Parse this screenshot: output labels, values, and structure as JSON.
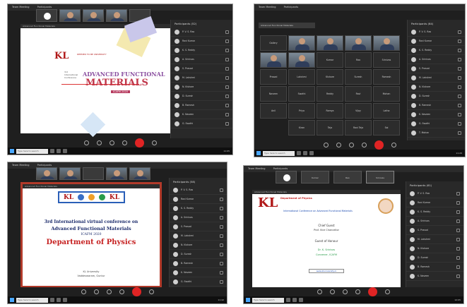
{
  "panels": [
    {
      "title_bar": "Team Meeting",
      "menu": "Participants",
      "share_title": "Advanced Functional Materials",
      "slide": {
        "logo": "KL",
        "logo_tagline": "DEEMED TO BE UNIVERSITY",
        "side_text": "3rd International Conference",
        "heading_line1": "ADVANCED FUNCTIONAL",
        "heading_line2": "MATERIALS",
        "badge": "ICAFM 2020"
      },
      "sidebar_title": "Participants (52)",
      "participants": [
        "P. V. S. Rao",
        "Ravi Kumar",
        "K. S. Reddy",
        "A. Srinivas",
        "S. Prasad",
        "M. Lakshmi",
        "N. Kishore",
        "D. Suresh",
        "B. Ramesh",
        "K. Naveen",
        "G. Swathi"
      ],
      "taskbar_search": "Type here to search",
      "clock": "11:05"
    },
    {
      "title_bar": "Team Meeting",
      "menu": "Participants",
      "share_title": "Advanced Functional Materials",
      "grid": [
        "Gallery",
        "Kumar",
        "Rao",
        "Srinivas",
        "Prasad",
        "Lakshmi",
        "Kishore",
        "Suresh",
        "Ramesh",
        "Naveen",
        "Swathi",
        "Reddy",
        "Ravi",
        "Mohan",
        "Anil",
        "Priya",
        "Ramya",
        "Vijay",
        "Latha",
        "Kiran",
        "Teja",
        "Ravi Teja",
        "Sai"
      ],
      "sidebar_title": "Participants (64)",
      "participants": [
        "P. V. S. Rao",
        "Ravi Kumar",
        "K. S. Reddy",
        "A. Srinivas",
        "S. Prasad",
        "M. Lakshmi",
        "N. Kishore",
        "D. Suresh",
        "B. Ramesh",
        "K. Naveen",
        "G. Swathi",
        "T. Mohan"
      ],
      "taskbar_search": "Type here to search",
      "clock": "11:20"
    },
    {
      "title_bar": "Team Meeting",
      "menu": "Participants",
      "share_title": "Advanced Functional Materials",
      "slide": {
        "banner": "KL",
        "line1": "3rd International virtual conference on",
        "line2": "Advanced Functional Materials",
        "line3": "ICAFM 2020",
        "line4": "Department of Physics",
        "footer1": "KL University",
        "footer2": "Vaddeswaram, Guntur"
      },
      "sidebar_title": "Participants (58)",
      "participants": [
        "P. V. S. Rao",
        "Ravi Kumar",
        "K. S. Reddy",
        "A. Srinivas",
        "S. Prasad",
        "M. Lakshmi",
        "N. Kishore",
        "D. Suresh",
        "B. Ramesh",
        "K. Naveen",
        "G. Swathi",
        "T. Mohan"
      ],
      "taskbar_search": "Type here to search",
      "clock": "11:42"
    },
    {
      "title_bar": "Team Meeting",
      "menu": "Participants",
      "share_title": "Advanced Functional Materials",
      "tiles": [
        "Kumar",
        "Rao",
        "Srinivas"
      ],
      "slide": {
        "logo": "KL",
        "red_title": "Department of Physics",
        "blue_title": "International Conference on Advanced Functional Materials",
        "item1": "Chief Guest",
        "item2": "Prof. Vice Chancellor",
        "item3": "Guest of Honour",
        "item4": "Dr. K. Srinivas",
        "item5": "Convener, ICAFM",
        "link": "www.kluniversity.in"
      },
      "sidebar_title": "Participants (61)",
      "participants": [
        "P. V. S. Rao",
        "Ravi Kumar",
        "K. S. Reddy",
        "A. Srinivas",
        "S. Prasad",
        "M. Lakshmi",
        "N. Kishore",
        "D. Suresh",
        "B. Ramesh",
        "K. Naveen"
      ],
      "taskbar_search": "Type here to search",
      "clock": "12:05"
    }
  ]
}
